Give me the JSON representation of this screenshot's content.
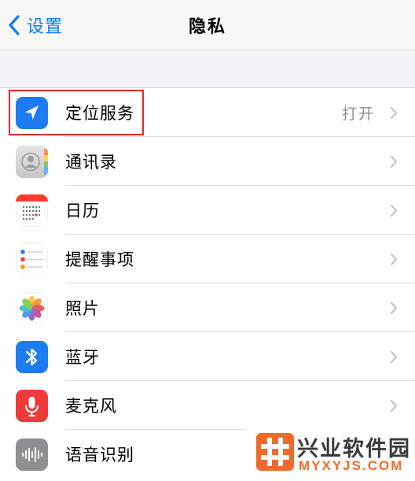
{
  "navbar": {
    "back_label": "设置",
    "title": "隐私"
  },
  "rows": [
    {
      "label": "定位服务",
      "value": "打开",
      "icon": "location-arrow-icon",
      "color": "#1e7cf2"
    },
    {
      "label": "通讯录",
      "icon": "contacts-icon",
      "color": "#c9c9cc"
    },
    {
      "label": "日历",
      "icon": "calendar-icon",
      "color": "#ff3b30"
    },
    {
      "label": "提醒事项",
      "icon": "reminders-icon",
      "color": "#ffffff"
    },
    {
      "label": "照片",
      "icon": "photos-icon",
      "color": "#ffffff"
    },
    {
      "label": "蓝牙",
      "icon": "bluetooth-icon",
      "color": "#1e7cf2"
    },
    {
      "label": "麦克风",
      "icon": "microphone-icon",
      "color": "#ee3a3a"
    },
    {
      "label": "语音识别",
      "icon": "speech-recognition-icon",
      "color": "#8e8e93"
    }
  ],
  "highlight": {
    "color": "#e02a2a"
  },
  "watermark": {
    "name": "兴业软件园",
    "url": "MYXYJS.COM",
    "accent": "#f26a2a"
  }
}
